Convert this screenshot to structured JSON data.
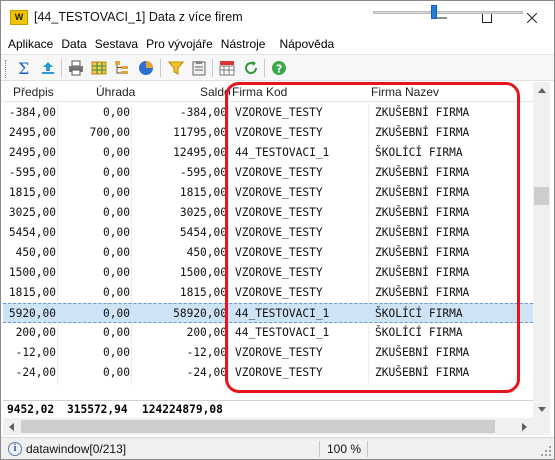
{
  "window": {
    "logo_text": "W",
    "title": "[44_TESTOVACI_1] Data z více firem"
  },
  "menu": [
    "Aplikace",
    "Data",
    "Sestava",
    "Pro vývojáře",
    "Nástroje",
    "Nápověda"
  ],
  "toolbar": {
    "icons": [
      "sum-icon",
      "export-icon",
      "print-icon",
      "grid-export-icon",
      "tree-icon",
      "pie-chart-icon",
      "filter-icon",
      "clipboard-icon",
      "table-settings-icon",
      "refresh-icon",
      "help-icon"
    ]
  },
  "grid": {
    "columns": [
      "Předpis",
      "Úhrada",
      "Saldo",
      "Firma Kod",
      "Firma Nazev"
    ],
    "rows": [
      {
        "predpis": "-384,00",
        "uhrada": "0,00",
        "saldo": "-384,00",
        "kod": "VZOROVE_TESTY",
        "nazev": "ZKUŠEBNÍ FIRMA"
      },
      {
        "predpis": "2495,00",
        "uhrada": "700,00",
        "saldo": "11795,00",
        "kod": "VZOROVE_TESTY",
        "nazev": "ZKUŠEBNÍ FIRMA"
      },
      {
        "predpis": "2495,00",
        "uhrada": "0,00",
        "saldo": "12495,00",
        "kod": "44_TESTOVACI_1",
        "nazev": "ŠKOLÍCÍ FIRMA"
      },
      {
        "predpis": "-595,00",
        "uhrada": "0,00",
        "saldo": "-595,00",
        "kod": "VZOROVE_TESTY",
        "nazev": "ZKUŠEBNÍ FIRMA"
      },
      {
        "predpis": "1815,00",
        "uhrada": "0,00",
        "saldo": "1815,00",
        "kod": "VZOROVE_TESTY",
        "nazev": "ZKUŠEBNÍ FIRMA"
      },
      {
        "predpis": "3025,00",
        "uhrada": "0,00",
        "saldo": "3025,00",
        "kod": "VZOROVE_TESTY",
        "nazev": "ZKUŠEBNÍ FIRMA"
      },
      {
        "predpis": "5454,00",
        "uhrada": "0,00",
        "saldo": "5454,00",
        "kod": "VZOROVE_TESTY",
        "nazev": "ZKUŠEBNÍ FIRMA"
      },
      {
        "predpis": "450,00",
        "uhrada": "0,00",
        "saldo": "450,00",
        "kod": "VZOROVE_TESTY",
        "nazev": "ZKUŠEBNÍ FIRMA"
      },
      {
        "predpis": "1500,00",
        "uhrada": "0,00",
        "saldo": "1500,00",
        "kod": "VZOROVE_TESTY",
        "nazev": "ZKUŠEBNÍ FIRMA"
      },
      {
        "predpis": "1815,00",
        "uhrada": "0,00",
        "saldo": "1815,00",
        "kod": "VZOROVE_TESTY",
        "nazev": "ZKUŠEBNÍ FIRMA"
      },
      {
        "predpis": "5920,00",
        "uhrada": "0,00",
        "saldo": "58920,00",
        "kod": "44_TESTOVACI_1",
        "nazev": "ŠKOLÍCÍ FIRMA",
        "selected": true
      },
      {
        "predpis": "200,00",
        "uhrada": "0,00",
        "saldo": "200,00",
        "kod": "44_TESTOVACI_1",
        "nazev": "ŠKOLÍCÍ FIRMA"
      },
      {
        "predpis": "-12,00",
        "uhrada": "0,00",
        "saldo": "-12,00",
        "kod": "VZOROVE_TESTY",
        "nazev": "ZKUŠEBNÍ FIRMA"
      },
      {
        "predpis": "-24,00",
        "uhrada": "0,00",
        "saldo": "-24,00",
        "kod": "VZOROVE_TESTY",
        "nazev": "ZKUŠEBNÍ FIRMA"
      }
    ],
    "totals": {
      "predpis": "9452,02",
      "uhrada": "315572,94",
      "saldo": "124224879,08"
    }
  },
  "status": {
    "text": "datawindow[0/213]",
    "zoom": "100 %",
    "zoom_level": 0.41
  },
  "colors": {
    "highlight": "#e8141b",
    "selection": "#cde4f7",
    "zoom_thumb": "#1f7ee0"
  }
}
